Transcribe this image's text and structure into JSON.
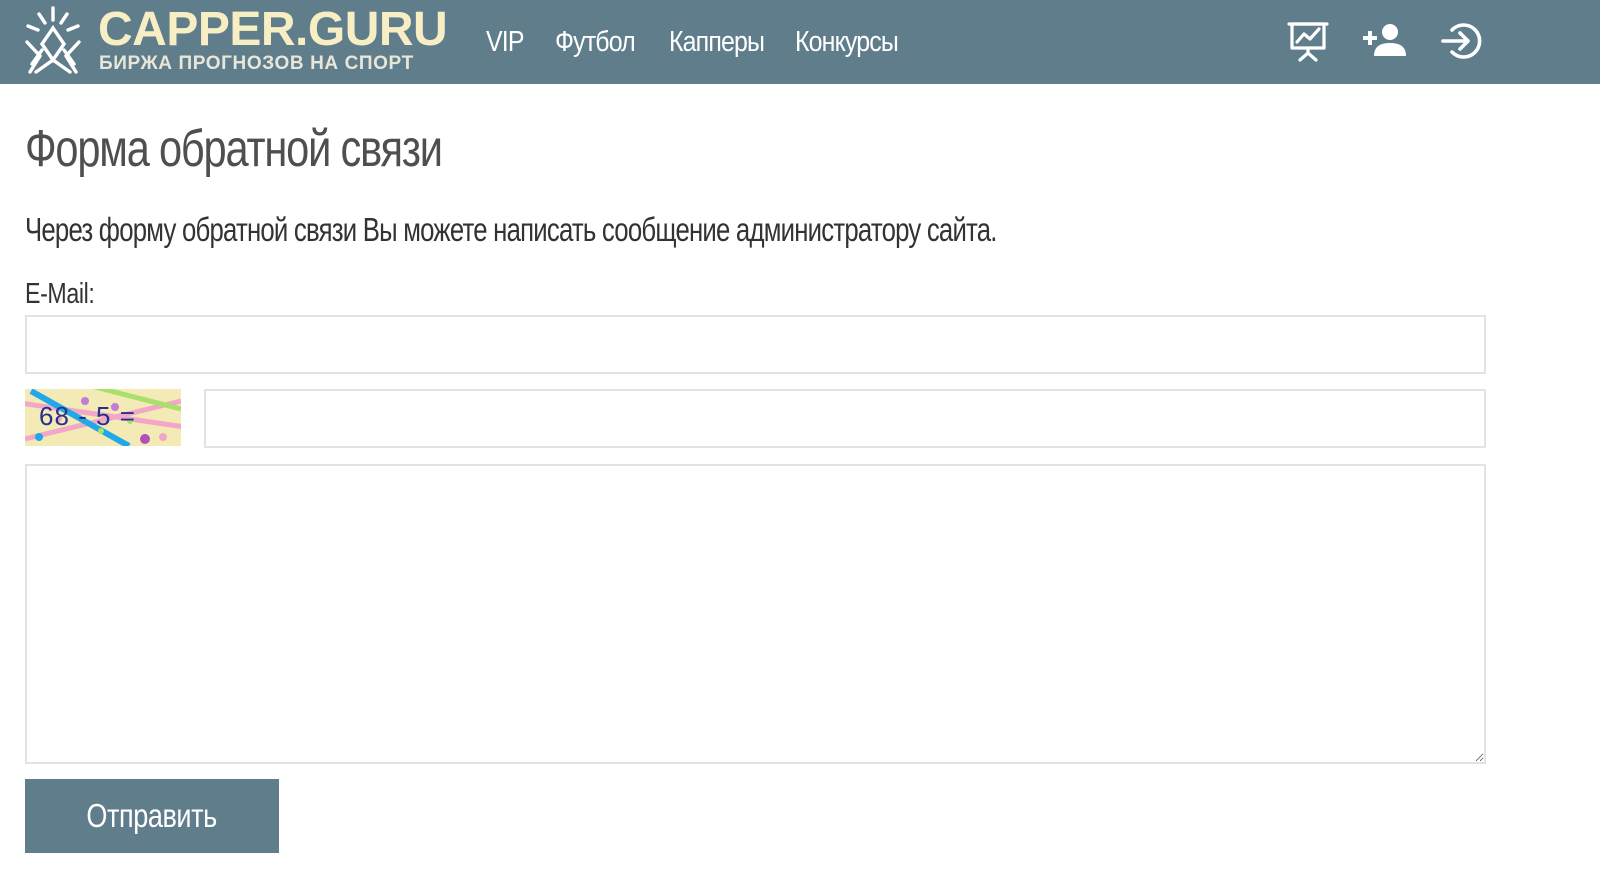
{
  "header": {
    "logo_title": "CAPPER.GURU",
    "logo_subtitle": "БИРЖА ПРОГНОЗОВ НА СПОРТ",
    "nav": [
      {
        "label": "VIP"
      },
      {
        "label": "Футбол"
      },
      {
        "label": "Капперы"
      },
      {
        "label": "Конкурсы"
      }
    ],
    "icons": [
      "stats-board-icon",
      "add-user-icon",
      "login-icon"
    ]
  },
  "main": {
    "title": "Форма обратной связи",
    "intro": "Через форму обратной связи Вы можете написать сообщение администратору сайта.",
    "email_label": "E-Mail:",
    "email_value": "",
    "captcha_text": "68 - 5 =",
    "captcha_value": "",
    "message_value": "",
    "submit_label": "Отправить"
  },
  "colors": {
    "header_bg": "#607d8b",
    "logo_text": "#f7eec3",
    "button_bg": "#607d8b",
    "input_border": "#e3e3e3"
  }
}
